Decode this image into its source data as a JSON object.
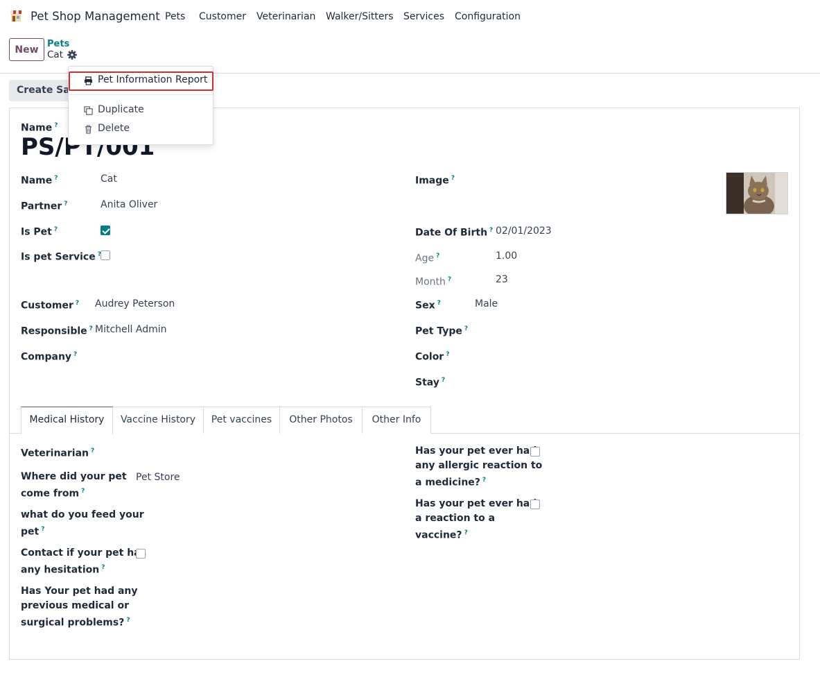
{
  "navbar": {
    "app_name": "Pet Shop Management",
    "menu": [
      "Pets",
      "Customer",
      "Veterinarian",
      "Walker/Sitters",
      "Services",
      "Configuration"
    ]
  },
  "control_panel": {
    "new_label": "New",
    "breadcrumb_parent": "Pets",
    "breadcrumb_current": "Cat"
  },
  "statusbar": {
    "create_sale_label": "Create Sale"
  },
  "dropdown": {
    "items": [
      "Pet Information Report",
      "Duplicate",
      "Delete"
    ]
  },
  "form": {
    "title_label": "Name",
    "record_name": "PS/PT/001",
    "left": {
      "name_label": "Name",
      "name_value": "Cat",
      "partner_label": "Partner",
      "partner_value": "Anita Oliver",
      "is_pet_label": "Is Pet",
      "is_pet_checked": true,
      "is_pet_service_label": "Is pet Service",
      "is_pet_service_checked": false,
      "customer_label": "Customer",
      "customer_value": "Audrey Peterson",
      "responsible_label": "Responsible",
      "responsible_value": "Mitchell Admin",
      "company_label": "Company"
    },
    "right": {
      "image_label": "Image",
      "dob_label": "Date Of Birth",
      "dob_value": "02/01/2023",
      "age_label": "Age",
      "age_value": "1.00",
      "month_label": "Month",
      "month_value": "23",
      "sex_label": "Sex",
      "sex_value": "Male",
      "pet_type_label": "Pet Type",
      "color_label": "Color",
      "stay_label": "Stay"
    }
  },
  "tabs": [
    "Medical History",
    "Vaccine History",
    "Pet vaccines",
    "Other Photos",
    "Other Info"
  ],
  "medical": {
    "veterinarian_label": "Veterinarian",
    "where_from_label_1": "Where did your pet",
    "where_from_label_2": "come from",
    "where_from_value": "Pet Store",
    "feed_label_1": "what do you feed your",
    "feed_label_2": "pet",
    "contact_label_1": "Contact if your pet has",
    "contact_label_2": "any hesitation",
    "contact_checked": false,
    "problems_label_1": "Has Your pet had any",
    "problems_label_2": "previous medical or",
    "problems_label_3": "surgical problems?",
    "allergic_label_1": "Has your pet ever had",
    "allergic_label_2": "any allergic reaction to",
    "allergic_label_3": "a medicine?",
    "allergic_checked": false,
    "vaccine_label_1": "Has your pet ever had",
    "vaccine_label_2": "a reaction to a",
    "vaccine_label_3": "vaccine?",
    "vaccine_checked": false
  },
  "help_marker": "?",
  "colors": {
    "brand": "#714b67",
    "accent": "#017e84",
    "highlight": "#d32f2f"
  }
}
